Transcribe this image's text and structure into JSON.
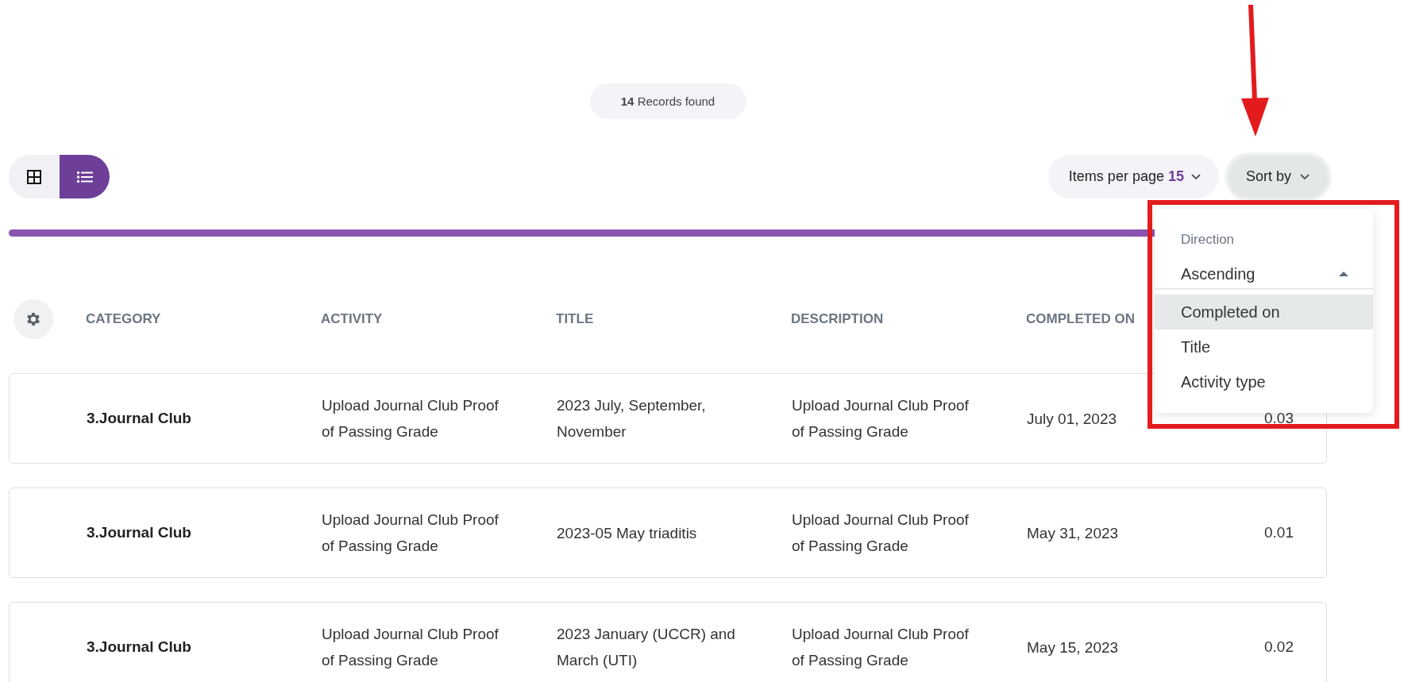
{
  "records": {
    "count": "14",
    "label": "Records found"
  },
  "view_toggle": [
    {
      "kind": "grid",
      "selected": false
    },
    {
      "kind": "list",
      "selected": true
    }
  ],
  "items_per_page": {
    "label": "Items per page",
    "value": "15"
  },
  "sort_button": {
    "label": "Sort by",
    "expanded": true
  },
  "table": {
    "columns": [
      "CATEGORY",
      "ACTIVITY",
      "TITLE",
      "DESCRIPTION",
      "COMPLETED ON"
    ],
    "rows": [
      {
        "category": "3.Journal Club",
        "activity": "Upload Journal Club Proof of Passing Grade",
        "title": "2023 July, September, November",
        "description": "Upload Journal Club Proof of Passing Grade",
        "completed_on": "July 01, 2023",
        "column_6": "0.03"
      },
      {
        "category": "3.Journal Club",
        "activity": "Upload Journal Club Proof of Passing Grade",
        "title": "2023-05 May triaditis",
        "description": "Upload Journal Club Proof of Passing Grade",
        "completed_on": "May 31, 2023",
        "column_6": "0.01"
      },
      {
        "category": "3.Journal Club",
        "activity": "Upload Journal Club Proof of Passing Grade",
        "title": "2023 January (UCCR) and March (UTI)",
        "description": "Upload Journal Club Proof of Passing Grade",
        "completed_on": "May 15, 2023",
        "column_6": "0.02"
      }
    ]
  },
  "sort_menu": {
    "direction_label": "Direction",
    "direction": "Ascending",
    "options": [
      {
        "label": "Completed on",
        "selected": true
      },
      {
        "label": "Title",
        "selected": false
      },
      {
        "label": "Activity type",
        "selected": false
      }
    ]
  }
}
